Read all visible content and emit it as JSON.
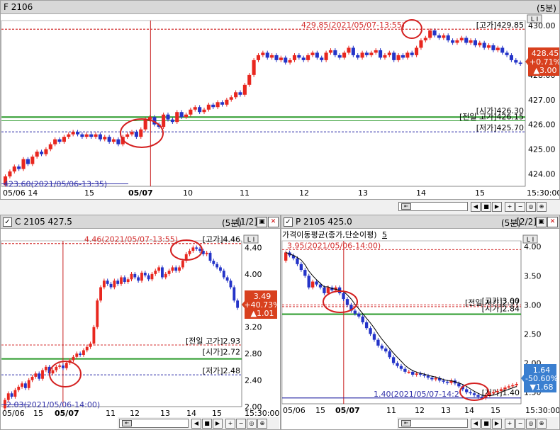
{
  "colors": {
    "up": "#e8271f",
    "down": "#2434c8",
    "high_line": "#d43030",
    "low_line": "#3333aa",
    "open_line": "#2a9a2a",
    "prevhigh_line": "#2a9a2a",
    "ma": "#000000",
    "circle": "#d42020",
    "vline": "#c82020",
    "badge_up": "#d8401e",
    "badge_down": "#3a7fd0"
  },
  "top": {
    "title": "F 2106",
    "period": "(5분)",
    "high_label": "429.85(2021/05/07-13:55)",
    "low_label": "423.60(2021/05/06-13:35)",
    "tags": {
      "high": "[고가]429.85",
      "open": "[시가]426.30",
      "prevhigh": "[전일 고가]426.15",
      "low": "[저가]425.70"
    },
    "badge": {
      "price": "428.45",
      "pct": "+0.71%",
      "chg": "▲3.00"
    },
    "yticks": [
      "430.00",
      "429.00",
      "428.00",
      "427.00",
      "426.00",
      "425.00",
      "424.00"
    ],
    "xticks": [
      "05/06 14",
      "15",
      "05/07",
      "10",
      "11",
      "12",
      "13",
      "14",
      "15",
      "15:30:00"
    ],
    "ctrl": "L I"
  },
  "call": {
    "title": "C 2105 427.5",
    "period": "(5분)",
    "page": "[1/2]",
    "high_label": "4.46(2021/05/07-13:55)",
    "low_label": "2.03(2021/05/06-14:00)",
    "tags": {
      "high": "[고가]4.46",
      "prevhigh": "[전일 고가]2.93",
      "open": "[시가]2.72",
      "low": "[저가]2.48"
    },
    "badge": {
      "price": "3.49",
      "pct": "+40.73%",
      "chg": "▲1.01"
    },
    "yticks": [
      "4.40",
      "4.00",
      "3.60",
      "3.20",
      "2.80",
      "2.40",
      "2.00"
    ],
    "xticks": [
      "05/06",
      "15",
      "05/07",
      "11",
      "12",
      "13",
      "14",
      "15",
      "15:30:00"
    ],
    "ctrl": "L I"
  },
  "put": {
    "title": "P 2105 425.0",
    "period": "(5분)",
    "page": "[2/2]",
    "ma_label": "가격이동평균(종가,단순이평)",
    "ma_period": "5",
    "high_label": "3.95(2021/05/06-14:00)",
    "low_label": "1.40(2021/05/07-14:2",
    "tags": {
      "high": "[고가]3.00",
      "prevhigh": "[전일 저가]2.97",
      "open": "[시가]2.84",
      "low": "[저가]1.40"
    },
    "badge": {
      "price": "1.64",
      "pct": "-50.60%",
      "chg": "▼1.68"
    },
    "yticks": [
      "4.00",
      "3.50",
      "3.00",
      "2.50",
      "2.00",
      "1.50"
    ],
    "xticks": [
      "05/06",
      "15",
      "05/07",
      "11",
      "12",
      "13",
      "14",
      "15",
      "15:30:00"
    ],
    "ctrl": "L I"
  },
  "toolbar_icons": [
    "play-prev",
    "stop",
    "play-next",
    "zoom-in",
    "zoom-out",
    "zoom-reset",
    "zoom-fit"
  ],
  "chart_data": [
    {
      "type": "candlestick",
      "title": "F 2106",
      "series": [
        {
          "name": "F 2106",
          "x_start": "2021/05/06 14:00",
          "interval_min": 5,
          "close": [
            423.9,
            424.1,
            424.3,
            424.2,
            424.6,
            424.4,
            424.7,
            424.9,
            424.8,
            425.0,
            425.2,
            425.4,
            425.3,
            425.5,
            425.6,
            425.7,
            425.6,
            425.5,
            425.6,
            425.5,
            425.6,
            425.4,
            425.5,
            425.3,
            425.4,
            425.2,
            425.5,
            425.6,
            425.7,
            425.5,
            425.8,
            426.2,
            426.3,
            426.0,
            425.9,
            426.4,
            426.2,
            426.1,
            426.5,
            426.3,
            426.4,
            426.6,
            426.7,
            426.5,
            426.6,
            426.8,
            426.7,
            426.9,
            426.8,
            427.0,
            427.1,
            427.3,
            427.2,
            427.6,
            428.0,
            428.6,
            428.8,
            428.9,
            428.7,
            428.8,
            428.6,
            428.7,
            428.5,
            428.6,
            428.8,
            428.7,
            428.6,
            428.8,
            428.9,
            428.7,
            428.6,
            428.9,
            429.0,
            428.8,
            428.7,
            428.9,
            429.1,
            428.8,
            428.7,
            428.9,
            428.8,
            428.9,
            429.0,
            428.7,
            428.8,
            428.9,
            428.6,
            428.8,
            428.7,
            428.9,
            428.8,
            429.1,
            429.4,
            429.5,
            429.8,
            429.6,
            429.5,
            429.6,
            429.4,
            429.3,
            429.4,
            429.5,
            429.3,
            429.4,
            429.2,
            429.3,
            429.1,
            429.2,
            429.0,
            429.1,
            428.9,
            428.8,
            428.6,
            428.5,
            428.45
          ]
        }
      ],
      "ylim": [
        423.5,
        430.2
      ]
    },
    {
      "type": "candlestick",
      "title": "C 2105 427.5",
      "series": [
        {
          "name": "C 2105 427.5",
          "close": [
            2.1,
            2.2,
            2.15,
            2.25,
            2.3,
            2.35,
            2.28,
            2.4,
            2.45,
            2.5,
            2.42,
            2.55,
            2.6,
            2.5,
            2.55,
            2.6,
            2.62,
            2.58,
            2.66,
            2.7,
            2.75,
            2.8,
            2.78,
            2.85,
            2.9,
            2.95,
            3.2,
            3.6,
            3.8,
            3.9,
            3.85,
            3.8,
            3.9,
            3.85,
            3.95,
            3.88,
            3.92,
            4.0,
            3.95,
            3.9,
            4.02,
            3.98,
            3.92,
            4.0,
            4.05,
            4.1,
            3.95,
            4.0,
            4.05,
            4.1,
            4.05,
            4.1,
            4.2,
            4.3,
            4.35,
            4.4,
            4.38,
            4.35,
            4.3,
            4.32,
            4.2,
            4.15,
            4.1,
            4.05,
            3.95,
            3.9,
            3.8,
            3.6,
            3.49
          ]
        }
      ],
      "ylim": [
        2.0,
        4.5
      ]
    },
    {
      "type": "candlestick",
      "title": "P 2105 425.0",
      "series": [
        {
          "name": "P 2105 425.0",
          "close": [
            3.9,
            3.85,
            3.8,
            3.7,
            3.6,
            3.5,
            3.3,
            3.4,
            3.35,
            3.3,
            3.2,
            3.3,
            3.25,
            3.3,
            3.2,
            3.1,
            3.0,
            2.9,
            2.85,
            2.8,
            2.7,
            2.6,
            2.5,
            2.4,
            2.3,
            2.25,
            2.2,
            2.1,
            2.0,
            1.95,
            1.9,
            1.85,
            1.85,
            1.8,
            1.82,
            1.8,
            1.78,
            1.75,
            1.72,
            1.74,
            1.7,
            1.68,
            1.66,
            1.7,
            1.65,
            1.6,
            1.55,
            1.5,
            1.48,
            1.45,
            1.42,
            1.4,
            1.45,
            1.48,
            1.5,
            1.52,
            1.55,
            1.58,
            1.6,
            1.62,
            1.64
          ]
        },
        {
          "name": "가격이동평균(종가,단순이평) 5",
          "values": "MA5"
        }
      ],
      "ylim": [
        1.3,
        4.1
      ]
    }
  ]
}
